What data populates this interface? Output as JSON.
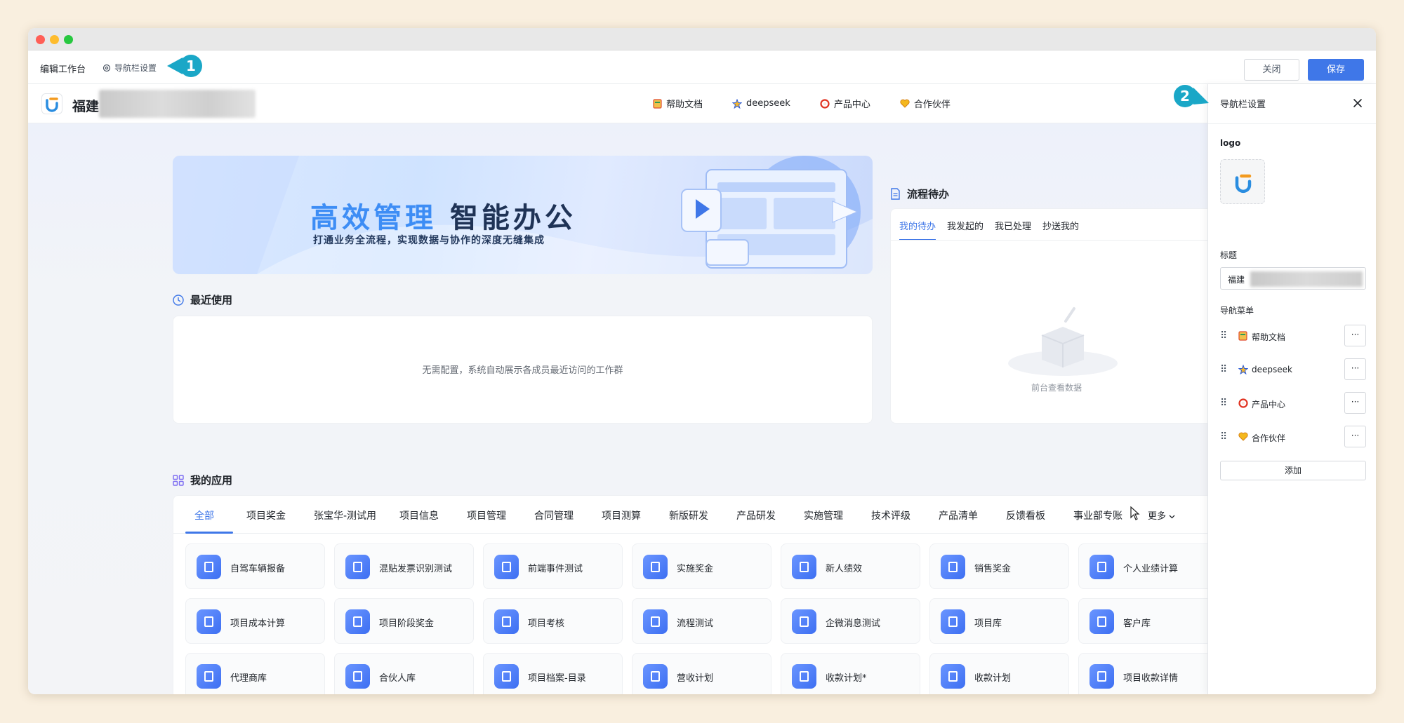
{
  "toolbar": {
    "edit_title": "编辑工作台",
    "nav_settings_link": "导航栏设置",
    "close_label": "关闭",
    "save_label": "保存"
  },
  "callouts": {
    "first": "1",
    "second": "2"
  },
  "topnav": {
    "brand_name": "福建",
    "links": [
      {
        "label": "帮助文档",
        "icon": "book-icon"
      },
      {
        "label": "deepseek",
        "icon": "star-icon"
      },
      {
        "label": "产品中心",
        "icon": "ring-icon"
      },
      {
        "label": "合作伙伴",
        "icon": "heart-icon"
      }
    ]
  },
  "banner": {
    "title_accent": "高效管理",
    "title_main": "智能办公",
    "subtitle": "打通业务全流程，实现数据与协作的深度无缝集成"
  },
  "recent": {
    "title": "最近使用",
    "note": "无需配置，系统自动展示各成员最近访问的工作群"
  },
  "workflow": {
    "title": "流程待办",
    "tabs": [
      "我的待办",
      "我发起的",
      "我已处理",
      "抄送我的"
    ],
    "empty_text": "前台查看数据"
  },
  "apps": {
    "title": "我的应用",
    "tabs": [
      "全部",
      "项目奖金",
      "张宝华-测试用",
      "项目信息",
      "项目管理",
      "合同管理",
      "项目测算",
      "新版研发",
      "产品研发",
      "实施管理",
      "技术评级",
      "产品清单",
      "反馈看板",
      "事业部专账"
    ],
    "more_label": "更多",
    "items": [
      [
        "自驾车辆报备",
        "混贴发票识别测试",
        "前端事件测试",
        "实施奖金",
        "新人绩效",
        "销售奖金",
        "个人业绩计算"
      ],
      [
        "项目成本计算",
        "项目阶段奖金",
        "项目考核",
        "流程测试",
        "企微消息测试",
        "项目库",
        "客户库"
      ],
      [
        "代理商库",
        "合伙人库",
        "项目档案-目录",
        "营收计划",
        "收款计划*",
        "收款计划",
        "项目收款详情"
      ]
    ]
  },
  "panel": {
    "title": "导航栏设置",
    "logo_label": "logo",
    "title_label": "标题",
    "title_value": "福建",
    "menu_label": "导航菜单",
    "menu_items": [
      "帮助文档",
      "deepseek",
      "产品中心",
      "合作伙伴"
    ],
    "more_glyph": "···",
    "add_label": "添加"
  }
}
